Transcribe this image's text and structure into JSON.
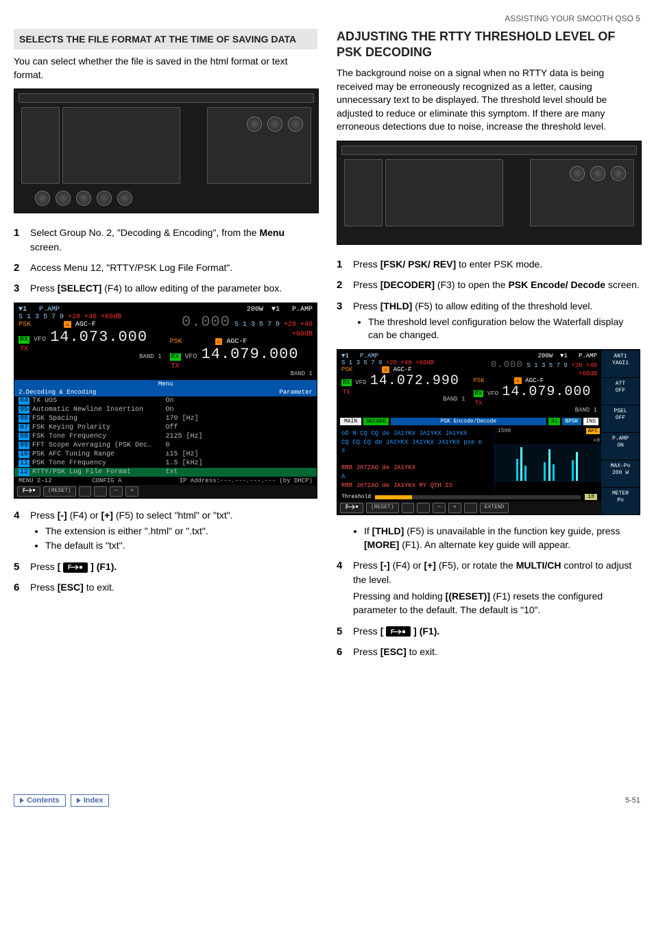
{
  "header": "ASSISTING YOUR SMOOTH QSO 5",
  "left": {
    "block_title": "SELECTS THE FILE FORMAT AT THE TIME OF SAVING DATA",
    "intro": "You can select whether the file is saved in the html format or text format.",
    "steps": [
      {
        "pre": "Select Group No. 2, \"Decoding & Encoding\", from the ",
        "bold": "Menu",
        "post": " screen."
      },
      {
        "pre": "Access Menu 12, \"RTTY/PSK Log File Format\"."
      },
      {
        "pre": "Press ",
        "bold": "[SELECT]",
        "post": " (F4) to allow editing of the parameter box."
      },
      {
        "pre": "Press ",
        "bold": "[-]",
        "mid": " (F4) or ",
        "bold2": "[+]",
        "post": " (F5) to select \"html\" or \"txt\".",
        "bullets": [
          "The extension is either \".html\" or \".txt\".",
          "The default is \"txt\"."
        ]
      },
      {
        "pre": "Press ",
        "bold": "[",
        "keyimg": true,
        "post": "] (F1)."
      },
      {
        "pre": "Press ",
        "bold": "[ESC]",
        "post": " to exit."
      }
    ],
    "menu": {
      "left_top_label": "P.AMP",
      "right_top_label": "P.AMP",
      "right_power": "200W",
      "mode_l": "PSK",
      "mode_r": "PSK",
      "agc": "AGC-F",
      "rx": "RX",
      "tx": "TX",
      "vfo": "VFO",
      "freq_l": "14.073.000",
      "freq_r_label": "0.000",
      "freq_r": "14.079.000",
      "band": "BAND 1",
      "menu_bar": "Menu",
      "group_label": "2.Decoding & Encoding",
      "param_label": "Parameter",
      "rows": [
        {
          "n": "04",
          "l": "TX UOS",
          "r": "On"
        },
        {
          "n": "05",
          "l": "Automatic Newline Insertion",
          "r": "On"
        },
        {
          "n": "06",
          "l": "FSK Spacing",
          "r": "170 [Hz]"
        },
        {
          "n": "07",
          "l": "FSK Keying Polarity",
          "r": "Off"
        },
        {
          "n": "08",
          "l": "FSK Tone Frequency",
          "r": "2125 [Hz]"
        },
        {
          "n": "09",
          "l": "FFT Scope Averaging (PSK Dec…",
          "r": "0"
        },
        {
          "n": "10",
          "l": "PSK AFC Tuning Range",
          "r": "±15 [Hz]"
        },
        {
          "n": "11",
          "l": "PSK Tone Frequency",
          "r": "1.5 [kHz]"
        },
        {
          "n": "12",
          "l": "RTTY/PSK Log File Format",
          "r": "txt",
          "sel": true
        }
      ],
      "ip_line": "IP Address:---.---.---.--- (by DHCP)",
      "menu_num": "MENU 2-12",
      "config": "CONFIG A",
      "foot": [
        "",
        "(RESET)",
        "",
        "",
        "—",
        "+"
      ]
    }
  },
  "right": {
    "h2": "ADJUSTING THE RTTY THRESHOLD LEVEL OF PSK DECODING",
    "intro": "The background noise on a signal when no RTTY data is being received may be erroneously recognized as a letter, causing unnecessary text to be displayed. The threshold level should be adjusted to reduce or eliminate this symptom. If there are many erroneous detections due to noise, increase the threshold level.",
    "steps": [
      {
        "pre": "Press ",
        "bold": "[FSK/ PSK/ REV]",
        "post": " to enter PSK mode."
      },
      {
        "pre": "Press ",
        "bold": "[DECODER]",
        "mid": " (F3) to open the ",
        "bold2": "PSK Encode/ Decode",
        "post": " screen."
      },
      {
        "pre": "Press ",
        "bold": "[THLD]",
        "post": " (F5) to allow editing of the threshold level.",
        "bullets": [
          "The threshold level configuration below the Waterfall display can be changed."
        ]
      },
      {
        "pre": "Press ",
        "bold": "[-]",
        "mid": " (F4) or ",
        "bold2": "[+]",
        "mid2": " (F5), or rotate the ",
        "bold3": "MULTI/CH",
        "post": " control to adjust the level.",
        "note_pre": "Pressing and holding ",
        "note_b": "[(RESET)]",
        "note_post": " (F1) resets the configured parameter to the default. The default is \"10\"."
      },
      {
        "pre": "Press ",
        "bold": "[",
        "keyimg": true,
        "post": "] (F1)."
      },
      {
        "pre": "Press ",
        "bold": "[ESC]",
        "post": " to exit."
      }
    ],
    "bullet_after_fig": {
      "pre": "If ",
      "b": "[THLD]",
      "mid": " (F5) is unavailable in the function key guide, press ",
      "b2": "[MORE]",
      "post": " (F1). An alternate key guide will appear."
    },
    "decode": {
      "left_top_label": "P.AMP",
      "right_top_label": "P.AMP",
      "right_power": "200W",
      "mode_l": "PSK",
      "mode_r": "PSK",
      "agc": "AGC-F",
      "rx": "RX",
      "tx": "TX",
      "vfo": "VFO",
      "freq_l": "14.072.990",
      "freq_r_label": "0.000",
      "freq_r": "14.079.000",
      "band": "BAND 1",
      "tabs_l": [
        "MAIN",
        "DECODE"
      ],
      "bar_title": "PSK Encode/Decode",
      "badges": [
        "31",
        "BPSK",
        "INS"
      ],
      "scale_l": "1500",
      "scale_r": "+0",
      "afc": "AFC",
      "lines": [
        {
          "c": "blue",
          "t": "oD N CQ CQ de JA1YKX JA1YKX JA1YKX"
        },
        {
          "c": "blue",
          "t": "CQ CQ CQ de JA1YKX JA1YKX JA1YKX pse K"
        },
        {
          "c": "blue",
          "t": "s"
        },
        {
          "c": "",
          "t": ""
        },
        {
          "c": "red",
          "t": "RRR JH7ZAO de JA1YKX"
        },
        {
          "c": "blue",
          "t": "A"
        },
        {
          "c": "red",
          "t": "RRR JH7ZAO de JA1YKX MY QTH IS"
        }
      ],
      "thr_label": "Threshold",
      "thr_val": "10",
      "side": [
        {
          "l1": "ANT1",
          "l2": "YAGI1"
        },
        {
          "l1": "ATT",
          "l2": "OFF"
        },
        {
          "l1": "PSEL",
          "l2": "OFF"
        },
        {
          "l1": "P.AMP",
          "l2": "ON"
        },
        {
          "l1": "MAX-Po",
          "l2": "200 W"
        },
        {
          "l1": "METER",
          "l2": "Po"
        }
      ],
      "foot": [
        "",
        "(RESET)",
        "",
        "",
        "—",
        "+",
        "",
        "EXTEND"
      ]
    }
  },
  "footer": {
    "contents": "Contents",
    "index": "Index",
    "page": "5-51"
  }
}
